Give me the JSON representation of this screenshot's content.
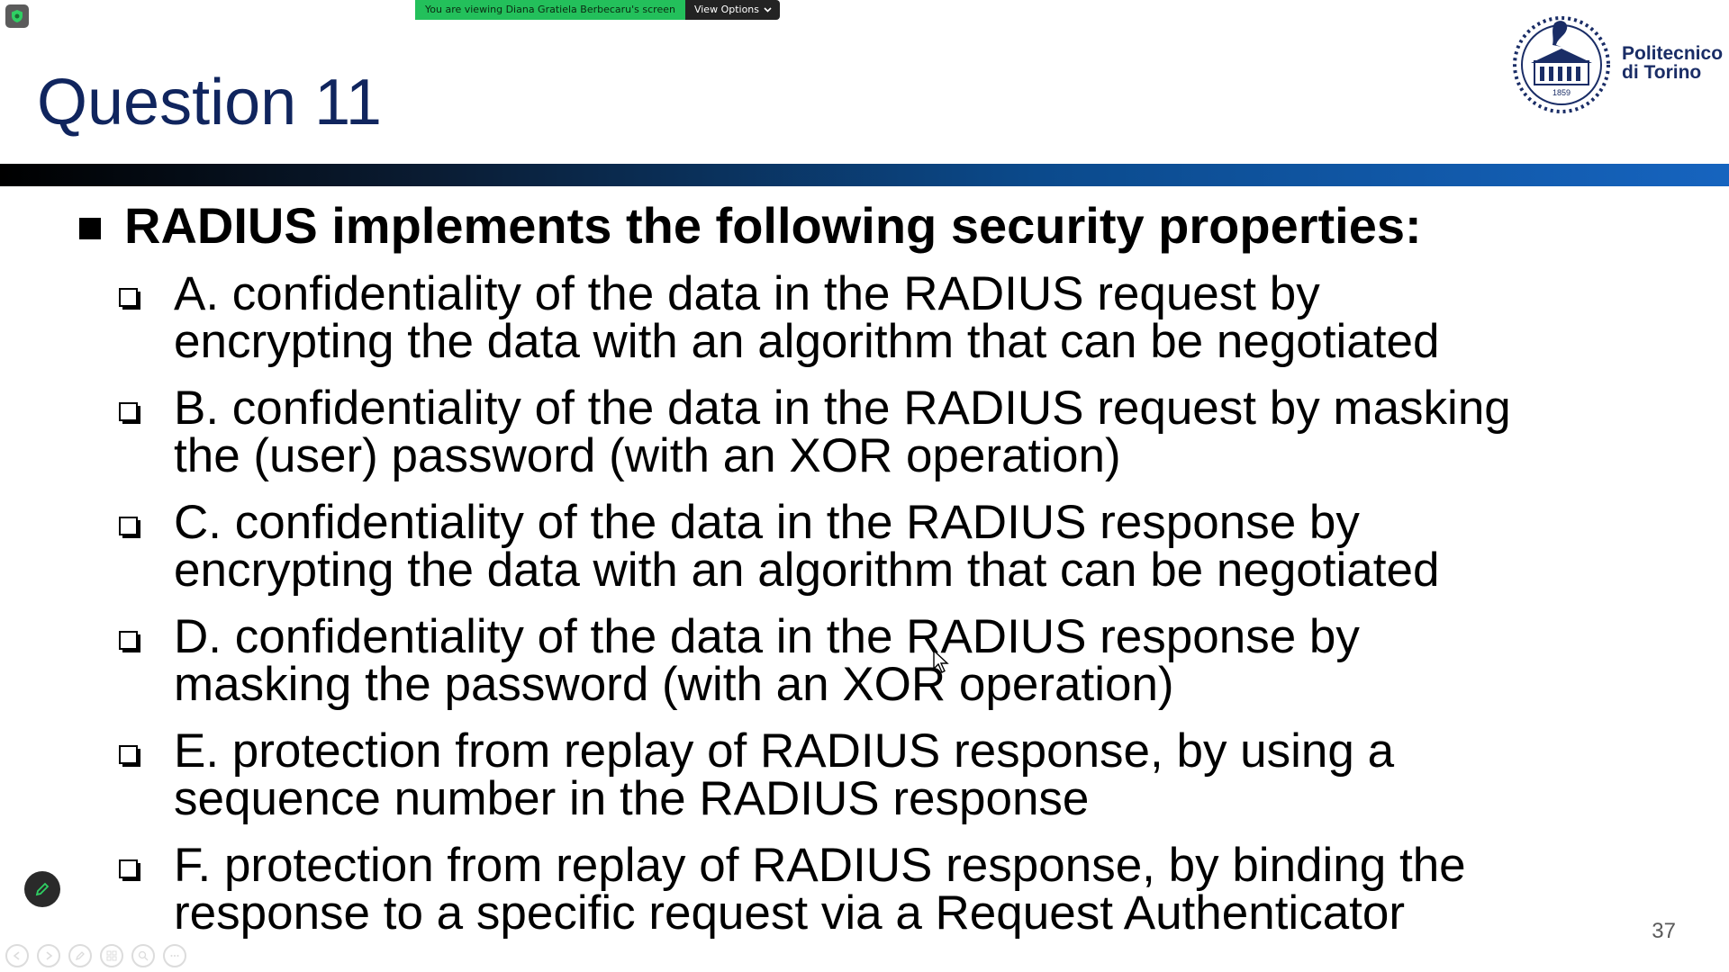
{
  "share_banner": {
    "viewing_text": "You are viewing Diana Gratiela Berbecaru's screen",
    "view_options_label": "View Options"
  },
  "slide": {
    "title": "Question 11",
    "logo": {
      "name_line1": "Politecnico",
      "name_line2": "di Torino",
      "year": "1859"
    },
    "main_bullet": "RADIUS implements the following security properties:",
    "options": [
      {
        "line1": "A. confidentiality of the data in the RADIUS request by",
        "line2": "encrypting the data with an algorithm that can be negotiated"
      },
      {
        "line1": "B. confidentiality of the data in the RADIUS request by masking",
        "line2": "the (user) password (with an XOR operation)"
      },
      {
        "line1": "C. confidentiality of the data in the RADIUS response by",
        "line2": "encrypting the data with an algorithm that can be negotiated"
      },
      {
        "line1": "D. confidentiality of the data in the RADIUS response by",
        "line2": "masking the password (with an XOR operation)"
      },
      {
        "line1": "E. protection from replay of RADIUS response, by using a",
        "line2": "sequence number in the RADIUS response"
      },
      {
        "line1": "F. protection from replay of RADIUS response, by binding the",
        "line2": "response to a specific request via a Request Authenticator"
      }
    ],
    "page_number": "37"
  },
  "colors": {
    "title": "#10255e",
    "banner_green": "#23c05b",
    "banner_dark": "#232323",
    "rule_start": "#000000",
    "rule_end": "#1664bf"
  },
  "icons": {
    "app": "shield-icon",
    "view_options": "chevron-down-icon",
    "pen": "pen-icon",
    "tools": [
      "previous-icon",
      "next-icon",
      "pen-icon",
      "slides-icon",
      "zoom-icon",
      "more-icon"
    ]
  }
}
